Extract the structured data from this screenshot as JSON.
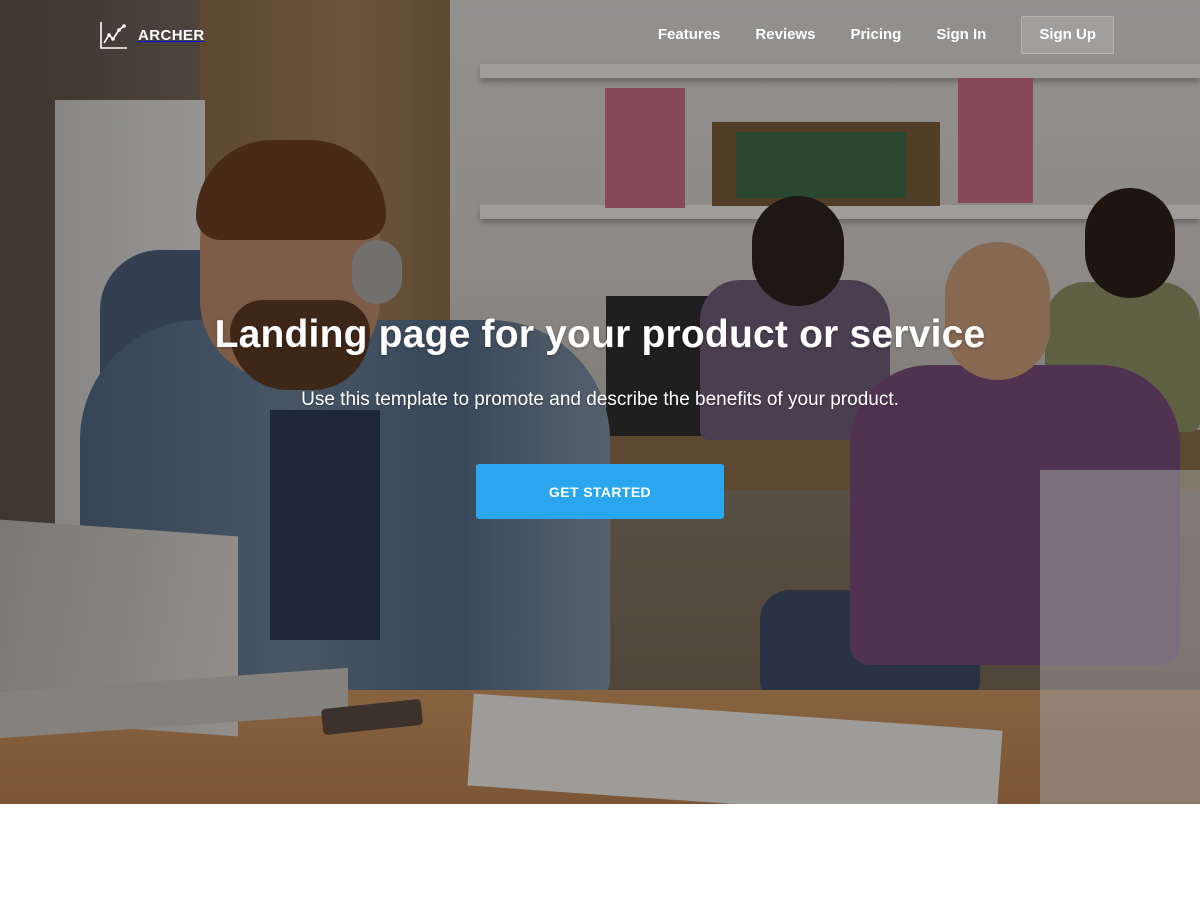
{
  "brand": {
    "name": "ARCHER",
    "logo_icon": "line-chart-icon"
  },
  "nav": {
    "links": [
      {
        "label": "Features"
      },
      {
        "label": "Reviews"
      },
      {
        "label": "Pricing"
      },
      {
        "label": "Sign In"
      },
      {
        "label": "Sign Up"
      }
    ]
  },
  "hero": {
    "title": "Landing page for your product or service",
    "subtitle": "Use this template to promote and describe the benefits of your product.",
    "cta_label": "GET STARTED",
    "background_image": "people working at laptops in an office"
  },
  "colors": {
    "accent": "#2aa6ef",
    "text_on_hero": "#ffffff",
    "page_background": "#ffffff"
  }
}
